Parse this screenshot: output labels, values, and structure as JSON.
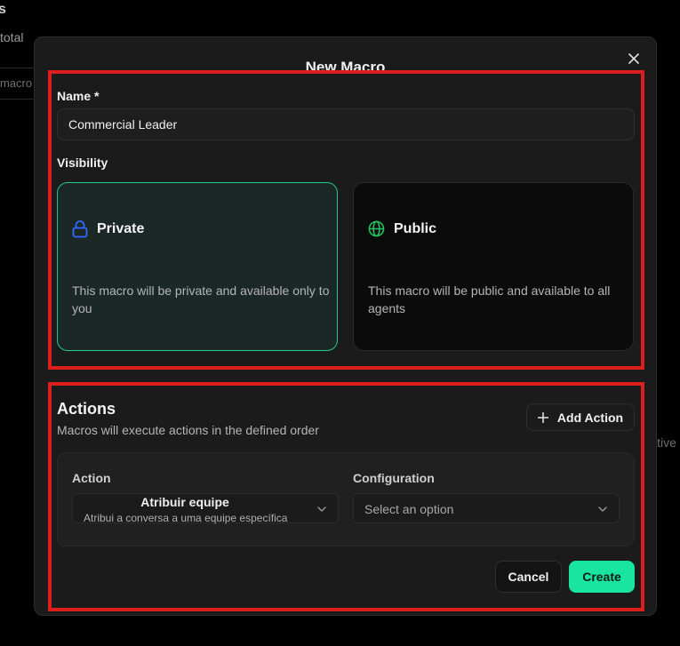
{
  "background": {
    "partial_s": "s",
    "total_label": "total",
    "search_placeholder": "macro",
    "partial_text_right": "itive"
  },
  "modal": {
    "title": "New Macro",
    "close_icon": "close-icon",
    "name_label": "Name *",
    "name_value": "Commercial Leader",
    "visibility_label": "Visibility",
    "visibility_options": [
      {
        "title": "Private",
        "icon": "lock-icon",
        "description": "This macro will be private and available only to you",
        "selected": true
      },
      {
        "title": "Public",
        "icon": "globe-icon",
        "description": "This macro will be public and available to all agents",
        "selected": false
      }
    ],
    "actions": {
      "title": "Actions",
      "subtitle": "Macros will execute actions in the defined order",
      "add_button": "Add Action",
      "column_action": "Action",
      "column_configuration": "Configuration",
      "action_value": "Atribuir equipe",
      "action_description": "Atribui a conversa a uma equipe específica",
      "configuration_placeholder": "Select an option"
    },
    "cancel_label": "Cancel",
    "create_label": "Create"
  },
  "colors": {
    "accent": "#19e5a0",
    "selected_border": "#1dc99a",
    "highlight_box": "#dc1e1e",
    "lock_icon": "#2f6bff",
    "globe_icon": "#22c55e"
  }
}
